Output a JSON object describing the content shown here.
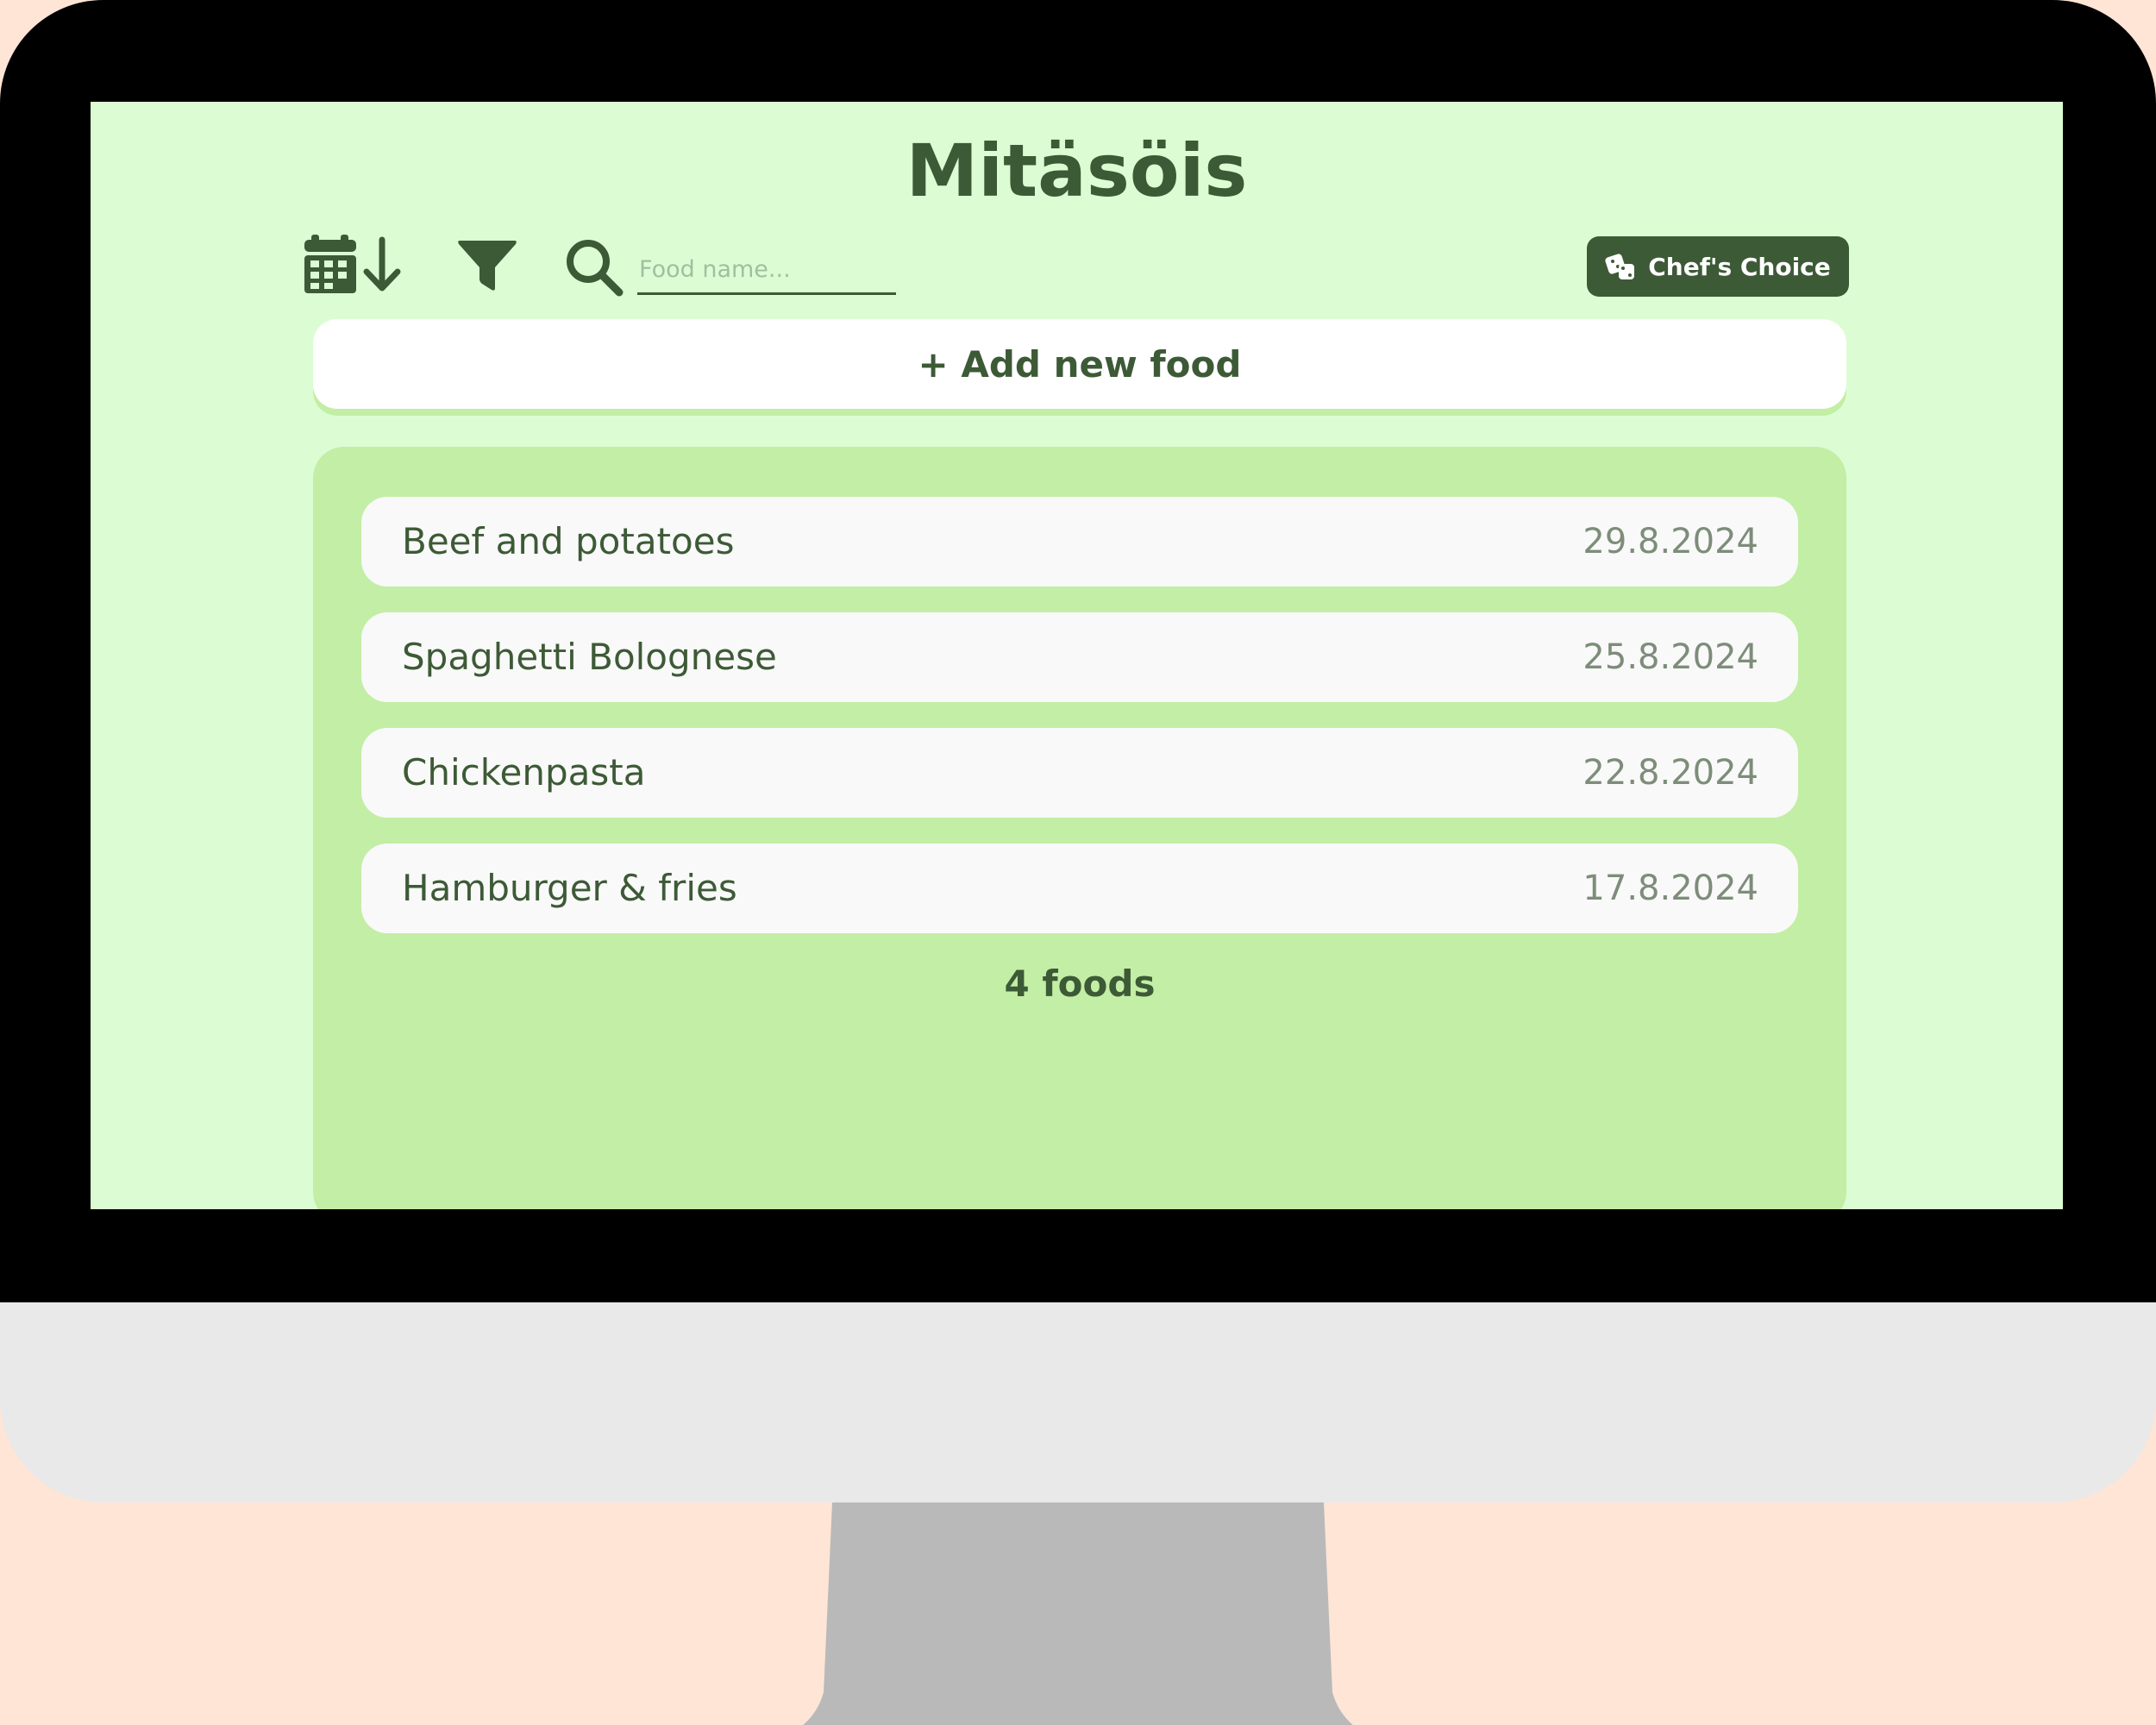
{
  "app": {
    "title": "Mitäsöis"
  },
  "toolbar": {
    "sort_icon": "calendar-sort-descending-icon",
    "filter_icon": "filter-funnel-icon",
    "search_icon": "magnifier-icon",
    "search_placeholder": "Food name...",
    "search_value": "",
    "chef_choice_label": "Chef's Choice",
    "chef_choice_icon": "dice-icon"
  },
  "add_food": {
    "label": "+ Add new food"
  },
  "foods": [
    {
      "name": "Beef and potatoes",
      "date": "29.8.2024"
    },
    {
      "name": "Spaghetti Bolognese",
      "date": "25.8.2024"
    },
    {
      "name": "Chickenpasta",
      "date": "22.8.2024"
    },
    {
      "name": "Hamburger & fries",
      "date": "17.8.2024"
    }
  ],
  "summary": {
    "count_label": "4 foods"
  },
  "colors": {
    "screen_background": "#dcfdd4",
    "panel_background": "#c3eea5",
    "accent_dark_green": "#3d5a36",
    "item_background": "#f9f9f9",
    "page_background": "#ffe5d6"
  }
}
